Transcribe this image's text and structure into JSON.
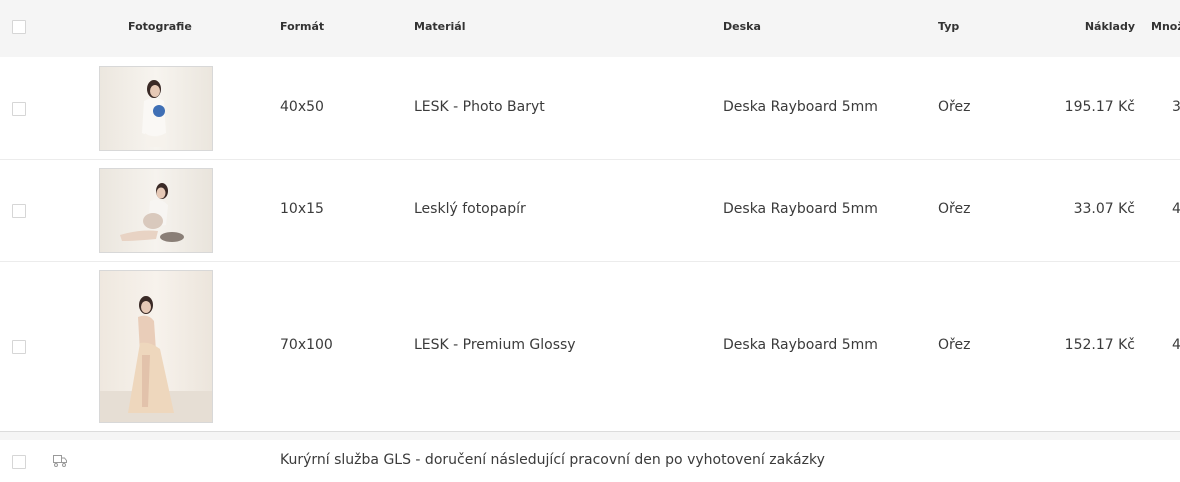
{
  "columns": {
    "photo": "Fotografie",
    "format": "Formát",
    "material": "Materiál",
    "board": "Deska",
    "type": "Typ",
    "cost": "Náklady",
    "quantity": "Množ"
  },
  "rows": [
    {
      "format": "40x50",
      "material": "LESK - Photo Baryt",
      "board": "Deska Rayboard 5mm",
      "type": "Ořez",
      "cost": "195.17 Kč",
      "quantity": "3"
    },
    {
      "format": "10x15",
      "material": "Lesklý fotopapír",
      "board": "Deska Rayboard 5mm",
      "type": "Ořez",
      "cost": "33.07 Kč",
      "quantity": "4"
    },
    {
      "format": "70x100",
      "material": "LESK - Premium Glossy",
      "board": "Deska Rayboard 5mm",
      "type": "Ořez",
      "cost": "152.17 Kč",
      "quantity": "4"
    }
  ],
  "shipping": {
    "label": "Kurýrní služba GLS - doručení následující pracovní den po vyhotovení zakázky",
    "icon": "truck-icon"
  }
}
